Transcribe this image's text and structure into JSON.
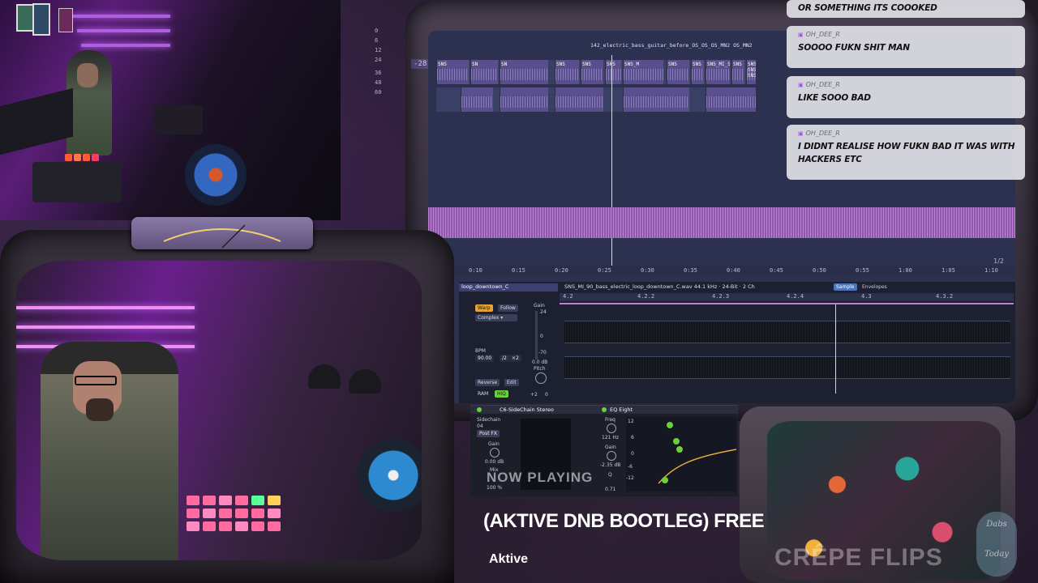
{
  "daw": {
    "lufs": "-28.7LUFS",
    "meter_scale": [
      "0",
      "6",
      "12",
      "24",
      "36",
      "48",
      "60"
    ],
    "arrangement_clip_title": "142_electric_bass_guitar_before_OS_OS_OS_MN2 OS_MN2",
    "clip_labels": [
      "SNS",
      "SN",
      "SN",
      "SNS",
      "SNS",
      "SNS",
      "SNS_M",
      "SNS",
      "SNS",
      "SNS_MI_SNS",
      "SNS",
      "SNS SNS SNS"
    ],
    "page_indicator": "1/2",
    "timeline": [
      "0:10",
      "0:15",
      "0:20",
      "0:25",
      "0:30",
      "0:35",
      "0:40",
      "0:45",
      "0:50",
      "0:55",
      "1:00",
      "1:05",
      "1:10"
    ],
    "clip_view": {
      "clip_name": "loop_downtown_C",
      "sample_info": "SNS_MI_90_bass_electric_loop_downtown_C.wav 44.1 kHz · 24-Bit · 2 Ch",
      "tab_sample": "Sample",
      "tab_envelopes": "Envelopes",
      "warp": "Warp",
      "follow": "Follow",
      "mode": "Complex",
      "bpm_label": "BPM",
      "bpm_value": "90.00",
      "half": "/2",
      "double": "×2",
      "gain_label": "Gain",
      "gain_value": "0.0 dB",
      "pitch_label": "Pitch",
      "pitch_value": "+2",
      "pitch_fine": "0",
      "reverse": "Reverse",
      "edit": "Edit",
      "ram": "RAM",
      "hiq": "HiQ",
      "ruler": [
        "4.2",
        "4.2.2",
        "4.2.3",
        "4.2.4",
        "4.3",
        "4.3.2"
      ],
      "gain_scale": [
        "24",
        "0",
        "-70"
      ]
    },
    "devices": {
      "sidechain_title": "C6-SideChain Stereo",
      "sidechain_label": "Sidechain",
      "sidechain_value": "04",
      "post_fx": "Post FX",
      "gain_label": "Gain",
      "gain_value": "0.00 dB",
      "mix_label": "Mix",
      "mix_value": "100 %",
      "eq_title": "EQ Eight",
      "freq_label": "Freq",
      "freq_value": "121 Hz",
      "eq_gain_label": "Gain",
      "eq_gain_value": "-2.35 dB",
      "q_label": "Q",
      "q_value": "0.71",
      "eq_scale": [
        "12",
        "6",
        "0",
        "-6",
        "-12"
      ]
    }
  },
  "chat": {
    "messages": [
      {
        "user": "",
        "text": "OR SOMETHING ITS COOOKED"
      },
      {
        "user": "OH_DEE_R",
        "text": "SOOOO FUKN SHIT MAN"
      },
      {
        "user": "OH_DEE_R",
        "text": "LIKE SOOO BAD"
      },
      {
        "user": "OH_DEE_R",
        "text": "I DIDNT REALISE HOW FUKN BAD IT WAS WITH HACKERS ETC"
      }
    ]
  },
  "now_playing": {
    "label": "NOW PLAYING",
    "title": "(AKTIVE DNB BOOTLEG) FREE",
    "artist": "Aktive"
  },
  "overlay": {
    "brand": "CRÊPE FLIPS",
    "badge_line1": "Dabs",
    "badge_line2": "Today"
  },
  "colors": {
    "accent_purple": "#b05ee0",
    "daw_bg": "#2c3150",
    "arrangement_strip": "#c07fd8"
  }
}
